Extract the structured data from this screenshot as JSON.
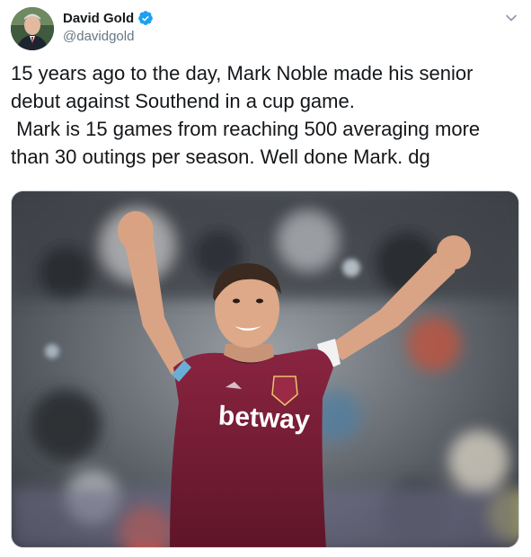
{
  "author": {
    "display_name": "David Gold",
    "handle": "@davidgold",
    "verified": true,
    "avatar_icon": "profile-photo"
  },
  "tweet": {
    "text": "15 years ago to the day, Mark Noble made his senior debut against Southend in a cup game.\n Mark is 15 games from reaching 500 averaging more than 30 outings per season. Well done Mark. dg"
  },
  "media": {
    "shirt_sponsor": "betway",
    "kind": "photo"
  },
  "menu": {
    "icon": "chevron-down-icon"
  },
  "colors": {
    "verified_blue": "#1da1f2",
    "handle_gray": "#657786",
    "text_dark": "#14171a",
    "claret": "#7a1f36"
  }
}
